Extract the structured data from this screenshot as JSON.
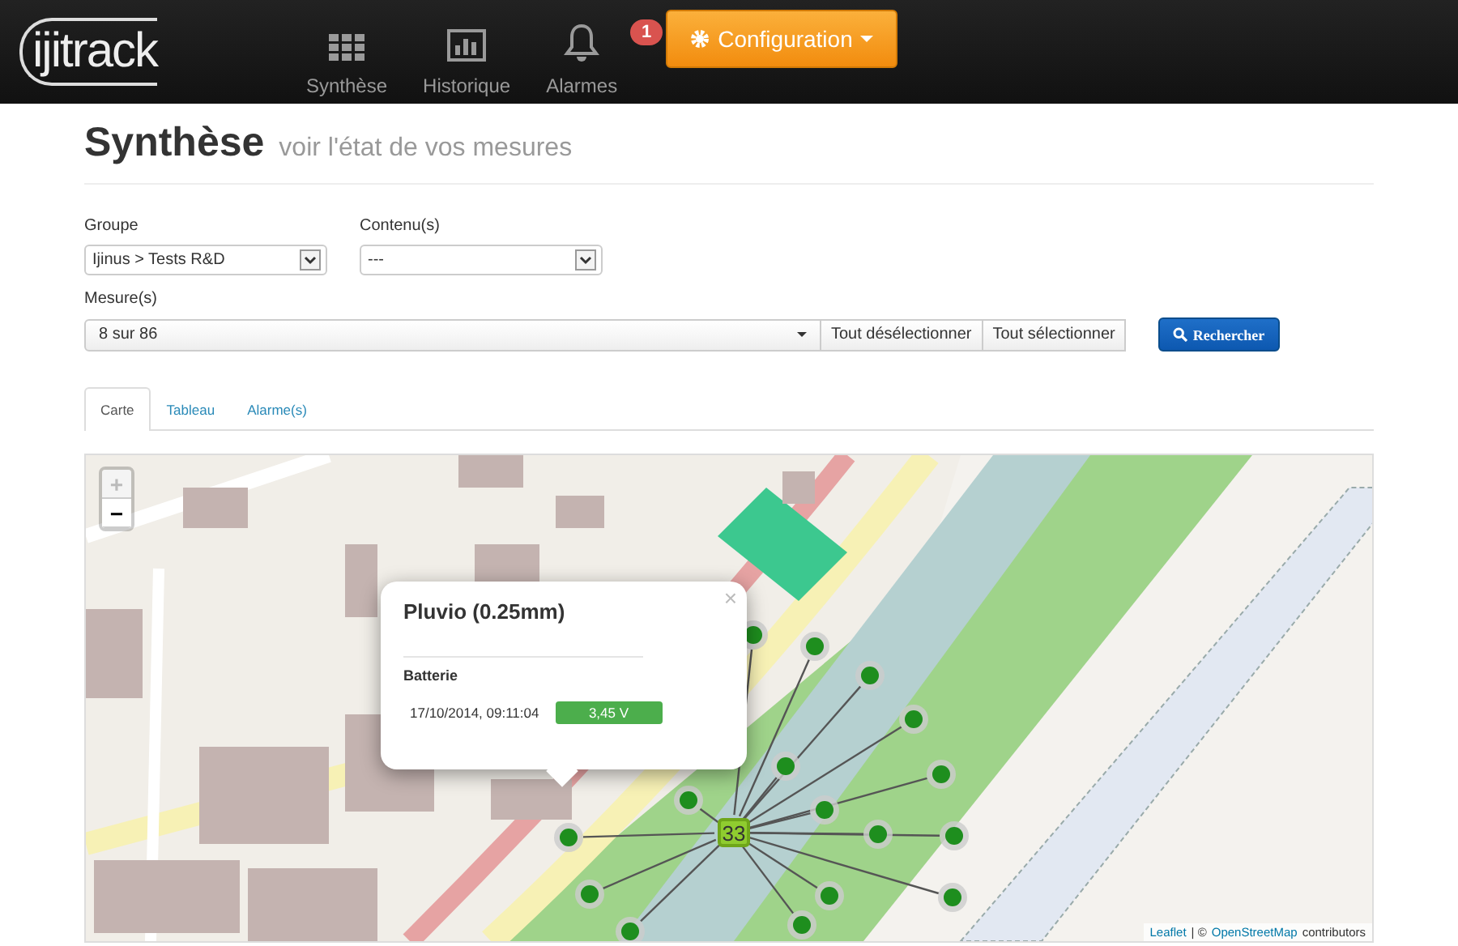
{
  "navbar": {
    "logo": "ijitrack",
    "items": [
      {
        "label": "Synthèse",
        "kind": "grid"
      },
      {
        "label": "Historique",
        "kind": "chart"
      },
      {
        "label": "Alarmes",
        "kind": "bell",
        "badge": "1"
      }
    ],
    "config_button": "Configuration"
  },
  "page": {
    "title": "Synthèse",
    "subtitle": "voir l'état de vos mesures"
  },
  "filters": {
    "groupe": {
      "label": "Groupe",
      "value": "Ijinus > Tests R&D"
    },
    "contenu": {
      "label": "Contenu(s)",
      "value": "---"
    },
    "mesures": {
      "label": "Mesure(s)",
      "value": "8 sur 86",
      "buttons": [
        "Tout désélectionner",
        "Tout sélectionner"
      ]
    },
    "search_button": "Rechercher"
  },
  "tabs": [
    {
      "label": "Carte",
      "selected": true
    },
    {
      "label": "Tableau",
      "selected": false
    },
    {
      "label": "Alarme(s)",
      "selected": false
    }
  ],
  "map": {
    "zoom_controls": [
      {
        "label": "+",
        "disabled": true
      },
      {
        "label": "−",
        "disabled": false
      }
    ],
    "cluster": "33",
    "popup": {
      "title": "Pluvio (0.25mm)",
      "close": "×",
      "section": "Batterie",
      "timestamp": "17/10/2014, 09:11:04",
      "reading": "3,45 V"
    },
    "attribution": {
      "leaflet": "Leaflet",
      "middle": "| ©",
      "osm": "OpenStreetMap",
      "suffix": "contributors"
    }
  }
}
